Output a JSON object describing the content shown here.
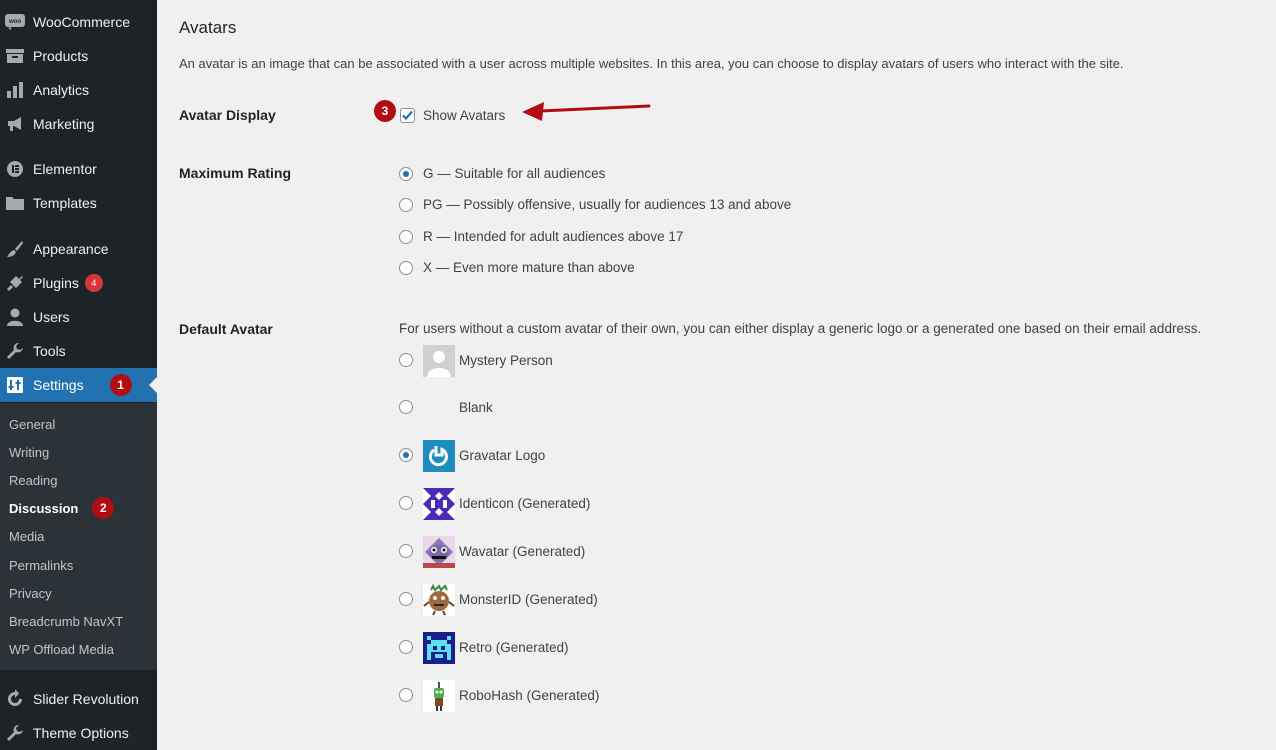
{
  "sidebar": {
    "menu": [
      {
        "label": "WooCommerce",
        "icon": "woocommerce-icon"
      },
      {
        "label": "Products",
        "icon": "archive-icon"
      },
      {
        "label": "Analytics",
        "icon": "bar-chart-icon"
      },
      {
        "label": "Marketing",
        "icon": "megaphone-icon"
      },
      {
        "label": "Elementor",
        "icon": "elementor-icon"
      },
      {
        "label": "Templates",
        "icon": "folder-icon"
      },
      {
        "label": "Appearance",
        "icon": "paintbrush-icon"
      },
      {
        "label": "Plugins",
        "icon": "plug-icon",
        "badge": "4"
      },
      {
        "label": "Users",
        "icon": "user-icon"
      },
      {
        "label": "Tools",
        "icon": "wrench-icon"
      },
      {
        "label": "Settings",
        "icon": "settings-icon",
        "annotation": "1"
      }
    ],
    "submenu": [
      {
        "label": "General"
      },
      {
        "label": "Writing"
      },
      {
        "label": "Reading"
      },
      {
        "label": "Discussion",
        "annotation": "2"
      },
      {
        "label": "Media"
      },
      {
        "label": "Permalinks"
      },
      {
        "label": "Privacy"
      },
      {
        "label": "Breadcrumb NavXT"
      },
      {
        "label": "WP Offload Media"
      }
    ],
    "bottom_menu": [
      {
        "label": "Slider Revolution",
        "icon": "refresh-icon"
      },
      {
        "label": "Theme Options",
        "icon": "wrench-icon"
      }
    ]
  },
  "main": {
    "title": "Avatars",
    "description": "An avatar is an image that can be associated with a user across multiple websites. In this area, you can choose to display avatars of users who interact with the site.",
    "avatar_display": {
      "label": "Avatar Display",
      "checkbox_label": "Show Avatars",
      "checked": true,
      "annotation": "3"
    },
    "max_rating": {
      "label": "Maximum Rating",
      "options": [
        "G — Suitable for all audiences",
        "PG — Possibly offensive, usually for audiences 13 and above",
        "R — Intended for adult audiences above 17",
        "X — Even more mature than above"
      ],
      "selected": 0
    },
    "default_avatar": {
      "label": "Default Avatar",
      "description": "For users without a custom avatar of their own, you can either display a generic logo or a generated one based on their email address.",
      "options": [
        "Mystery Person",
        "Blank",
        "Gravatar Logo",
        "Identicon (Generated)",
        "Wavatar (Generated)",
        "MonsterID (Generated)",
        "Retro (Generated)",
        "RoboHash (Generated)"
      ],
      "selected": 2
    }
  },
  "colors": {
    "sidebar_bg": "#1d2327",
    "submenu_bg": "#2c3338",
    "accent": "#2271b1",
    "annotation_red": "#b10c10",
    "badge_red": "#d63638"
  }
}
